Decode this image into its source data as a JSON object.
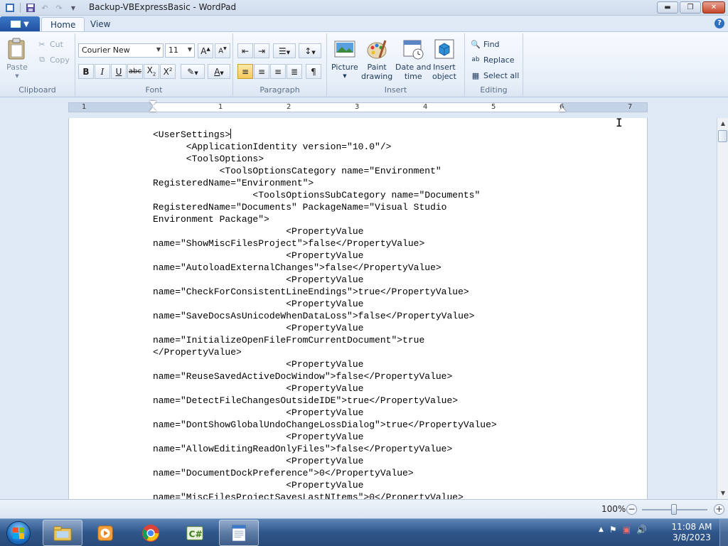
{
  "window": {
    "title": "Backup-VBExpressBasic - WordPad"
  },
  "qat": {
    "icons": [
      "save-icon",
      "undo-icon",
      "redo-icon",
      "customize-qat-icon"
    ]
  },
  "tabs": [
    {
      "label": "Home",
      "active": true
    },
    {
      "label": "View",
      "active": false
    }
  ],
  "clipboard": {
    "paste_label": "Paste",
    "cut_label": "Cut",
    "copy_label": "Copy",
    "group_label": "Clipboard"
  },
  "font": {
    "family": "Courier New",
    "size": "11",
    "group_label": "Font"
  },
  "paragraph": {
    "group_label": "Paragraph"
  },
  "insert": {
    "picture_label": "Picture",
    "paint_label": "Paint\ndrawing",
    "datetime_label": "Date and\ntime",
    "object_label": "Insert\nobject",
    "group_label": "Insert"
  },
  "editing": {
    "find_label": "Find",
    "replace_label": "Replace",
    "select_all_label": "Select all",
    "group_label": "Editing"
  },
  "ruler": {
    "numbers": [
      "1",
      "1",
      "2",
      "3",
      "4",
      "5",
      "6",
      "7"
    ]
  },
  "document": {
    "lines": [
      "<UserSettings>",
      "      <ApplicationIdentity version=\"10.0\"/>",
      "      <ToolsOptions>",
      "            <ToolsOptionsCategory name=\"Environment\"",
      "RegisteredName=\"Environment\">",
      "                  <ToolsOptionsSubCategory name=\"Documents\"",
      "RegisteredName=\"Documents\" PackageName=\"Visual Studio",
      "Environment Package\">",
      "                        <PropertyValue",
      "name=\"ShowMiscFilesProject\">false</PropertyValue>",
      "                        <PropertyValue",
      "name=\"AutoloadExternalChanges\">false</PropertyValue>",
      "                        <PropertyValue",
      "name=\"CheckForConsistentLineEndings\">true</PropertyValue>",
      "                        <PropertyValue",
      "name=\"SaveDocsAsUnicodeWhenDataLoss\">false</PropertyValue>",
      "                        <PropertyValue",
      "name=\"InitializeOpenFileFromCurrentDocument\">true",
      "</PropertyValue>",
      "                        <PropertyValue",
      "name=\"ReuseSavedActiveDocWindow\">false</PropertyValue>",
      "                        <PropertyValue",
      "name=\"DetectFileChangesOutsideIDE\">true</PropertyValue>",
      "                        <PropertyValue",
      "name=\"DontShowGlobalUndoChangeLossDialog\">true</PropertyValue>",
      "                        <PropertyValue",
      "name=\"AllowEditingReadOnlyFiles\">false</PropertyValue>",
      "                        <PropertyValue",
      "name=\"DocumentDockPreference\">0</PropertyValue>",
      "                        <PropertyValue",
      "name=\"MiscFilesProjectSavesLastNItems\">0</PropertyValue>"
    ]
  },
  "status": {
    "zoom": "100%",
    "zoom_fraction": 0.5
  },
  "taskbar": {
    "items": [
      "windows-explorer-icon",
      "media-player-icon",
      "chrome-icon",
      "csharp-express-icon",
      "wordpad-icon"
    ]
  },
  "clock": {
    "time": "11:08 AM",
    "date": "3/8/2023"
  },
  "colors": {
    "accent": "#2b5797",
    "active_button": "#f7c95e",
    "close_button": "#c7442a"
  }
}
